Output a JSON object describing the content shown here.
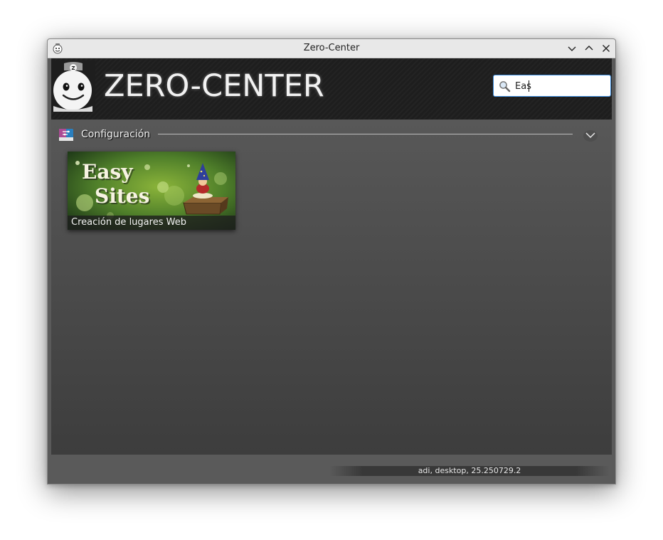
{
  "window": {
    "title": "Zero-Center"
  },
  "header": {
    "logo_text": "ZERO-CENTER",
    "logo_badge": "Z"
  },
  "search": {
    "value": "Eas",
    "icon": "magnifier-icon"
  },
  "section": {
    "title": "Configuración",
    "icon": "settings-category-icon",
    "collapse_icon": "chevron-down-icon"
  },
  "apps": [
    {
      "art_line1": "Easy",
      "art_line2": "Sites",
      "caption": "Creación de lugares Web"
    }
  ],
  "footer": {
    "status": "adi, desktop, 25.250729.2"
  },
  "colors": {
    "header_bg": "#1e1e1e",
    "content_bg": "#4a4a4a",
    "search_focus": "#3d8ee0"
  }
}
